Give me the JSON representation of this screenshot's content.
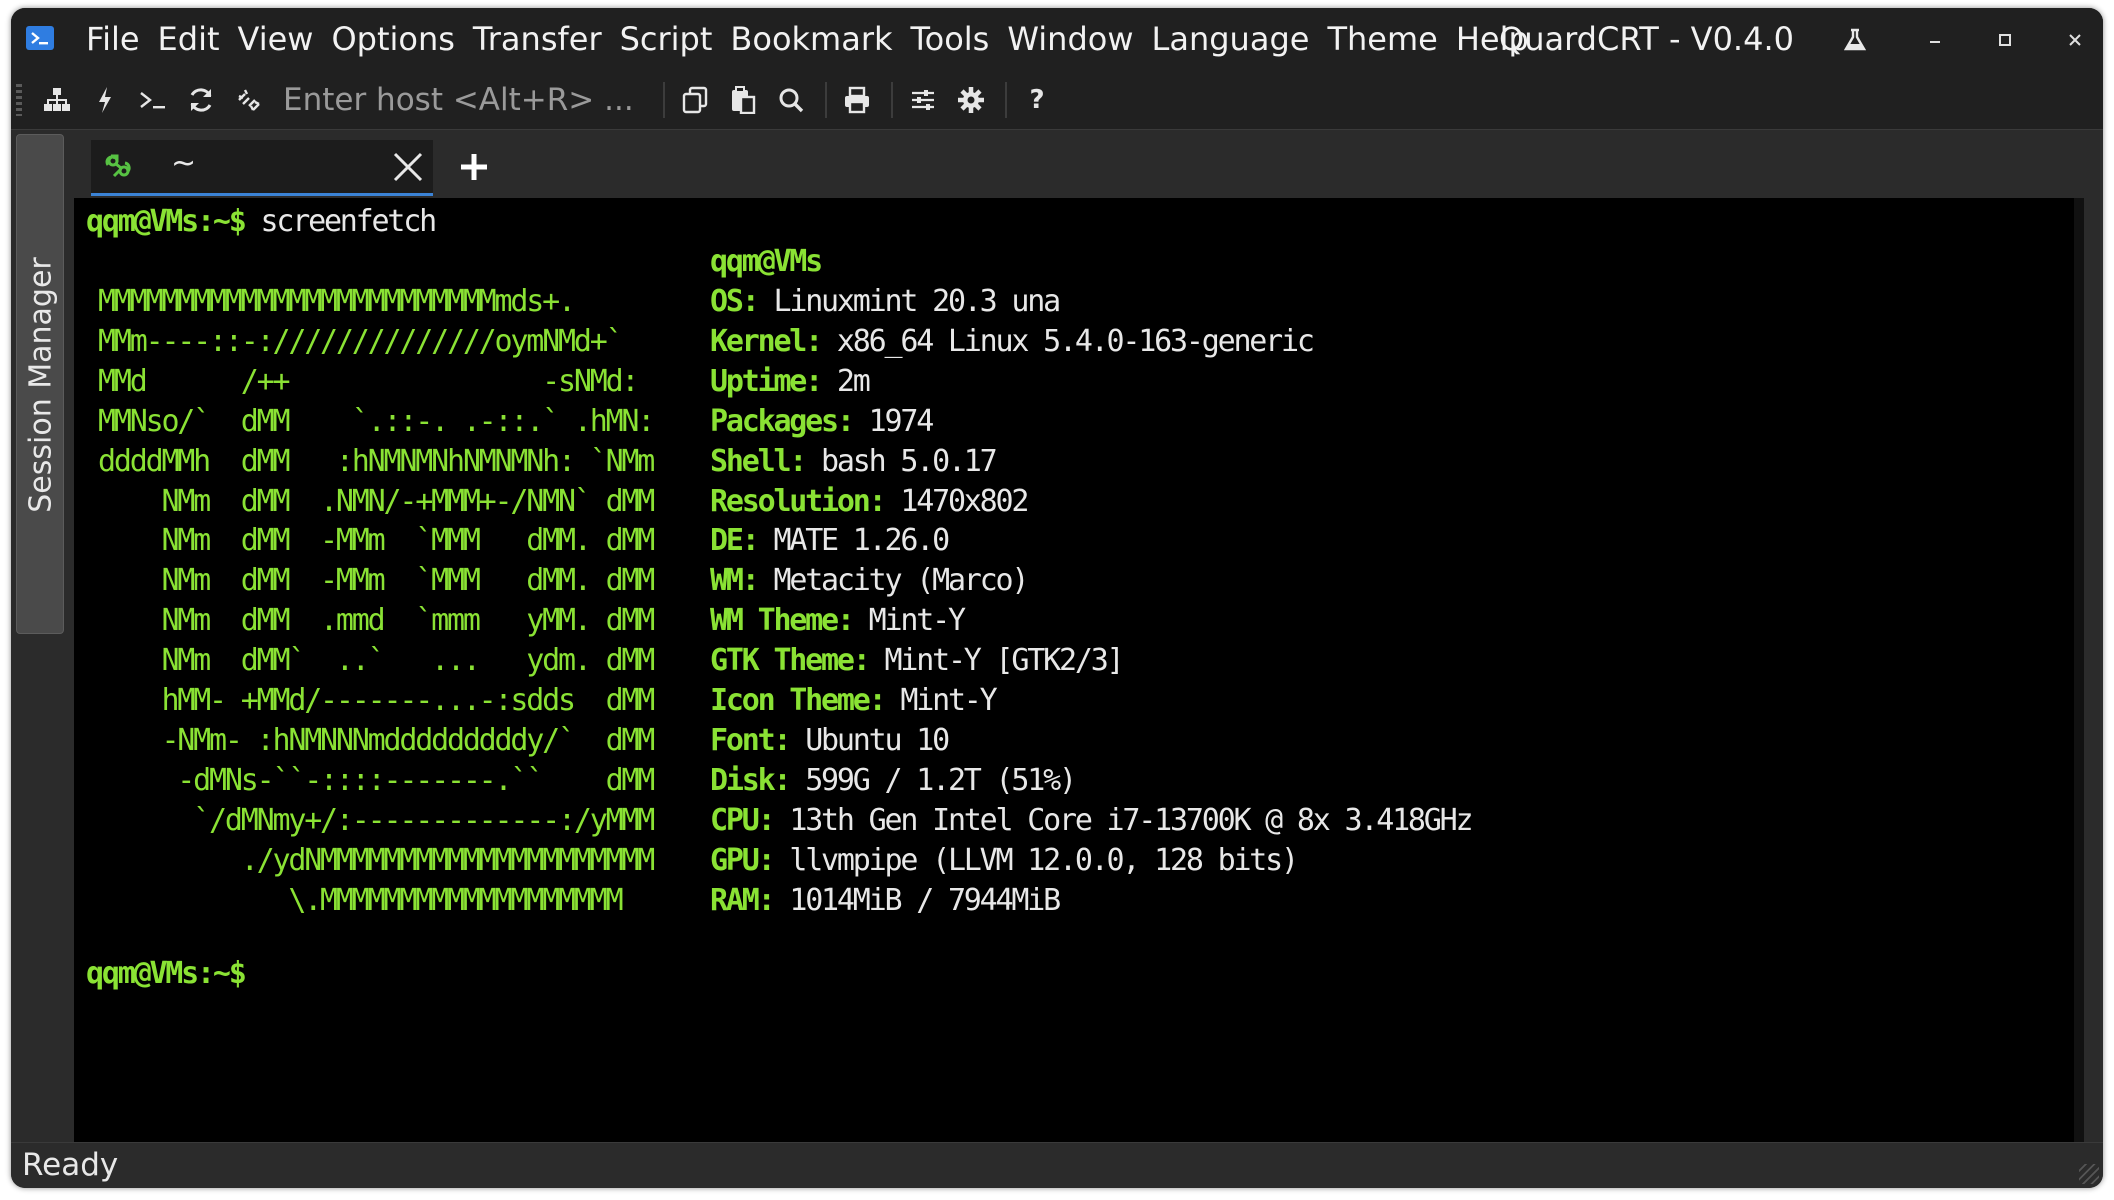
{
  "app": {
    "title": "QuardCRT - V0.4.0",
    "accent": "#3b83d6",
    "terminal_green": "#8ae234"
  },
  "menu": [
    "File",
    "Edit",
    "View",
    "Options",
    "Transfer",
    "Script",
    "Bookmark",
    "Tools",
    "Window",
    "Language",
    "Theme",
    "Help"
  ],
  "window_controls": [
    "lab-flask-icon",
    "minimize-icon",
    "maximize-icon",
    "close-icon"
  ],
  "toolbar": {
    "host_placeholder": "Enter host <Alt+R> ...",
    "icons": [
      "connect-tree-icon",
      "quick-connect-icon",
      "terminal-prompt-icon",
      "reconnect-icon",
      "disconnect-icon",
      "copy-icon",
      "paste-icon",
      "find-icon",
      "print-icon",
      "session-options-icon",
      "settings-gear-icon",
      "help-icon"
    ]
  },
  "session_manager": {
    "label": "Session Manager"
  },
  "tabs": [
    {
      "title": "~",
      "connected": true
    }
  ],
  "terminal": {
    "prompt_user": "qqm@VMs:~$",
    "command": "screenfetch",
    "header": "qqm@VMs",
    "logo": [
      "MMMMMMMMMMMMMMMMMMMMMMMMMmds+.",
      "MMm----::-://////////////oymNMd+`",
      "MMd      /++                -sNMd:",
      "MMNso/`  dMM    `.::-. .-::.` .hMN:",
      "ddddMMh  dMM   :hNMNMNhNMNMNh: `NMm",
      "    NMm  dMM  .NMN/-+MMM+-/NMN` dMM",
      "    NMm  dMM  -MMm  `MMM   dMM. dMM",
      "    NMm  dMM  -MMm  `MMM   dMM. dMM",
      "    NMm  dMM  .mmd  `mmm   yMM. dMM",
      "    NMm  dMM`  ..`   ...   ydm. dMM",
      "    hMM- +MMd/-------...-:sdds  dMM",
      "    -NMm- :hNMNNNmdddddddddy/`  dMM",
      "     -dMNs-``-::::-------.``    dMM",
      "      `/dMNmy+/:-------------:/yMMM",
      "         ./ydNMMMMMMMMMMMMMMMMMMMMM",
      "            \\.MMMMMMMMMMMMMMMMMMM"
    ],
    "info": [
      {
        "key": "OS:",
        "value": "Linuxmint 20.3 una"
      },
      {
        "key": "Kernel:",
        "value": "x86_64 Linux 5.4.0-163-generic"
      },
      {
        "key": "Uptime:",
        "value": "2m"
      },
      {
        "key": "Packages:",
        "value": "1974"
      },
      {
        "key": "Shell:",
        "value": "bash 5.0.17"
      },
      {
        "key": "Resolution:",
        "value": "1470x802"
      },
      {
        "key": "DE:",
        "value": "MATE 1.26.0"
      },
      {
        "key": "WM:",
        "value": "Metacity (Marco)"
      },
      {
        "key": "WM Theme:",
        "value": "Mint-Y"
      },
      {
        "key": "GTK Theme:",
        "value": "Mint-Y [GTK2/3]"
      },
      {
        "key": "Icon Theme:",
        "value": "Mint-Y"
      },
      {
        "key": "Font:",
        "value": "Ubuntu 10"
      },
      {
        "key": "Disk:",
        "value": "599G / 1.2T (51%)"
      },
      {
        "key": "CPU:",
        "value": "13th Gen Intel Core i7-13700K @ 8x 3.418GHz"
      },
      {
        "key": "GPU:",
        "value": "llvmpipe (LLVM 12.0.0, 128 bits)"
      },
      {
        "key": "RAM:",
        "value": "1014MiB / 7944MiB"
      }
    ]
  },
  "status": {
    "text": "Ready"
  }
}
